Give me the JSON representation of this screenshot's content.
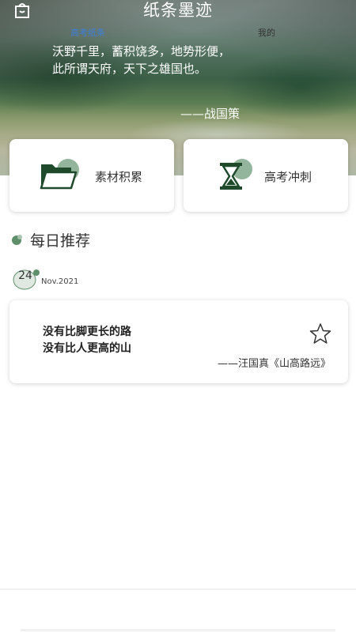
{
  "header": {
    "title": "纸条墨迹",
    "quote_text": "沃野千里，蓄积饶多，地势形便，此所谓天府，天下之雄国也。",
    "quote_source": "——战国策"
  },
  "cards": [
    {
      "label": "素材积累",
      "icon": "folder-icon"
    },
    {
      "label": "高考冲刺",
      "icon": "hourglass-icon"
    }
  ],
  "daily": {
    "section_title": "每日推荐",
    "day": "24",
    "month_year": "Nov.2021",
    "line1": "没有比脚更长的路",
    "line2": "没有比人更高的山",
    "source": "——汪国真《山高路远》"
  },
  "tabs": [
    {
      "label": "高考纸条",
      "active": true
    },
    {
      "label": "我的",
      "active": false
    }
  ],
  "colors": {
    "accent_green": "#5e8f6a",
    "icon_dark_green": "#1f4a2c",
    "active_tab": "#3e7fd9"
  }
}
